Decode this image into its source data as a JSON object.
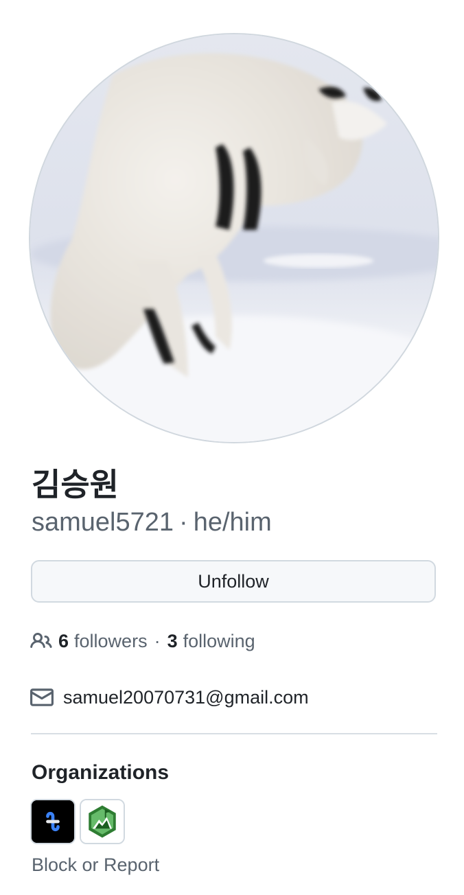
{
  "profile": {
    "display_name": "김승원",
    "login": "samuel5721",
    "pronouns": "he/him",
    "separator": "·"
  },
  "follow_button": {
    "label": "Unfollow"
  },
  "stats": {
    "followers_count": "6",
    "followers_label": "followers",
    "following_count": "3",
    "following_label": "following",
    "separator": "·"
  },
  "email": "samuel20070731@gmail.com",
  "organizations": {
    "heading": "Organizations",
    "items": [
      {
        "icon": "org-logo-blue-link",
        "background": "#000000"
      },
      {
        "icon": "org-logo-green-mountain",
        "background": "#ffffff"
      }
    ]
  },
  "block_report": "Block or Report",
  "colors": {
    "text_primary": "#1f2328",
    "text_muted": "#59636e",
    "border": "#d1d9e0",
    "button_bg": "#f6f8fa"
  }
}
